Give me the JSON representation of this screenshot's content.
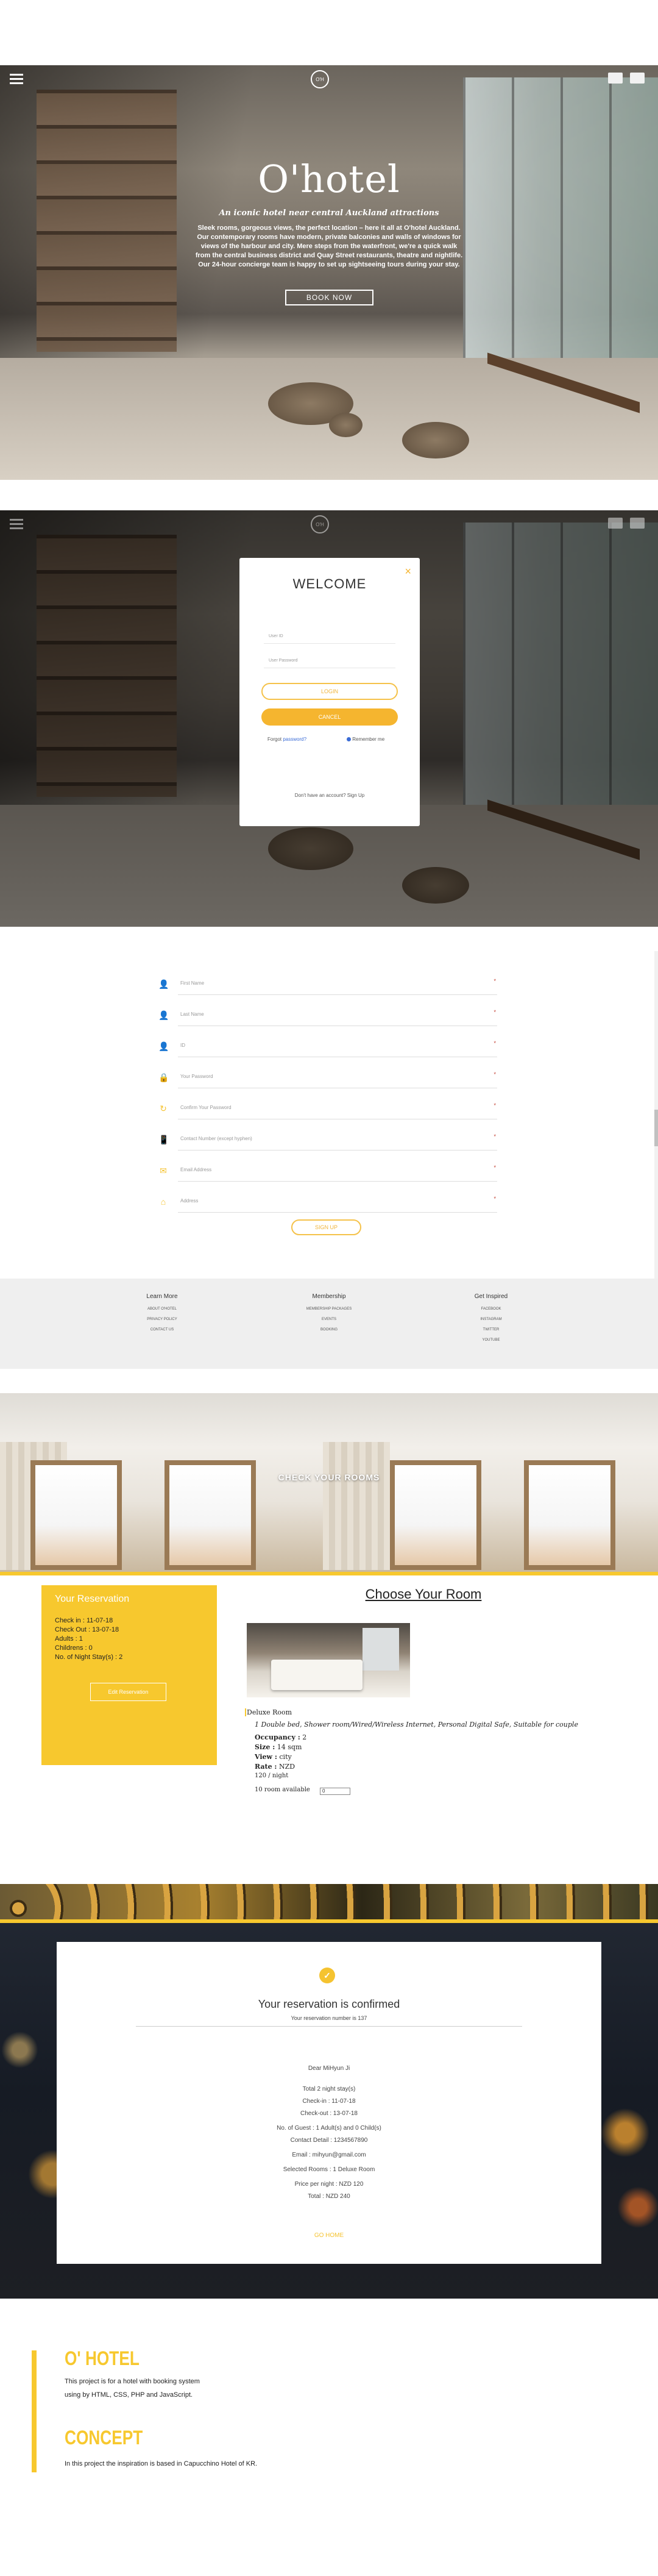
{
  "hero": {
    "logo": "O'H",
    "title": "O'hotel",
    "subtitle": "An iconic hotel near central Auckland attractions",
    "description": "Sleek rooms, gorgeous views, the perfect location – here it all at O'hotel Auckland. Our contemporary rooms have modern, private balconies and walls of windows for views of the harbour and city. Mere steps from the waterfront, we're a quick walk from the central business district and Quay Street restaurants, theatre and nightlife. Our 24-hour concierge team is happy to set up sightseeing tours during your stay.",
    "book_now": "BOOK NOW"
  },
  "login": {
    "title": "WELCOME",
    "close": "×",
    "user_id_placeholder": "User ID",
    "password_placeholder": "User Password",
    "login_btn": "LOGIN",
    "cancel_btn": "CANCEL",
    "forgot_prefix": "Forgot",
    "forgot_link": "password?",
    "remember": "Remember me",
    "no_account": "Don't have an account? Sign Up"
  },
  "signup": {
    "fields": [
      {
        "icon": "person-icon",
        "glyph": "👤",
        "placeholder": "First Name"
      },
      {
        "icon": "person-icon",
        "glyph": "👤",
        "placeholder": "Last Name"
      },
      {
        "icon": "person-icon",
        "glyph": "👤",
        "placeholder": "ID"
      },
      {
        "icon": "lock-icon",
        "glyph": "🔒",
        "placeholder": "Your Password"
      },
      {
        "icon": "refresh-icon",
        "glyph": "↻",
        "placeholder": "Confirm Your Password"
      },
      {
        "icon": "phone-icon",
        "glyph": "📱",
        "placeholder": "Contact Number (except hyphen)"
      },
      {
        "icon": "envelope-icon",
        "glyph": "✉",
        "placeholder": "Email Address"
      },
      {
        "icon": "home-icon",
        "glyph": "⌂",
        "placeholder": "Address"
      }
    ],
    "required_mark": "*",
    "submit": "SIGN UP"
  },
  "footer": {
    "columns": [
      {
        "title": "Learn More",
        "links": [
          "ABOUT O'HOTEL",
          "PRIVACY POLICY",
          "CONTACT US"
        ]
      },
      {
        "title": "Membership",
        "links": [
          "MEMBERSHIP PACKAGES",
          "EVENTS",
          "BOOKING"
        ]
      },
      {
        "title": "Get Inspired",
        "links": [
          "FACEBOOK",
          "INSTAGRAM",
          "TWITTER",
          "YOUTUBE"
        ]
      }
    ]
  },
  "rooms": {
    "hero_title": "CHECK YOUR ROOMS",
    "reservation": {
      "title": "Your Reservation",
      "lines": [
        "Check in : 11-07-18",
        "Check Out : 13-07-18",
        "Adults : 1",
        "Childrens : 0",
        "No. of Night Stay(s) : 2"
      ],
      "edit_btn": "Edit Reservation"
    },
    "choose_title": "Choose Your Room",
    "room": {
      "name": "Deluxe Room",
      "description": "1 Double bed, Shower room/Wired/Wireless Internet, Personal Digital Safe, Suitable for couple",
      "occupancy_label": "Occupancy :",
      "occupancy": "2",
      "size_label": "Size :",
      "size": "14 sqm",
      "view_label": "View :",
      "view": "city",
      "rate_label": "Rate :",
      "rate": "NZD",
      "price": "120 / night",
      "available": "10 room available",
      "select_value": "0"
    }
  },
  "confirmation": {
    "title": "Your reservation is confirmed",
    "number": "Your reservation number is 137",
    "details": [
      "Dear MiHyun Ji",
      "Total 2 night stay(s)",
      "Check-in : 11-07-18",
      "Check-out : 13-07-18",
      "No. of Guest : 1 Adult(s) and 0 Child(s)",
      "Contact Detail : 1234567890",
      "Email : mihyun@gmail.com",
      "Selected Rooms : 1 Deluxe Room",
      "Price per night : NZD 120",
      "Total : NZD 240"
    ],
    "go_home": "GO HOME"
  },
  "about": {
    "heading1": "O' HOTEL",
    "para1_line1": "This project is for a hotel with booking system",
    "para1_line2": "using by HTML, CSS, PHP and JavaScript.",
    "heading2": "CONCEPT",
    "para2": "In this project the inspiration is based in Capucchino Hotel of KR."
  },
  "colors": {
    "accent": "#f7c82e",
    "accent_dark": "#f5b52f"
  }
}
